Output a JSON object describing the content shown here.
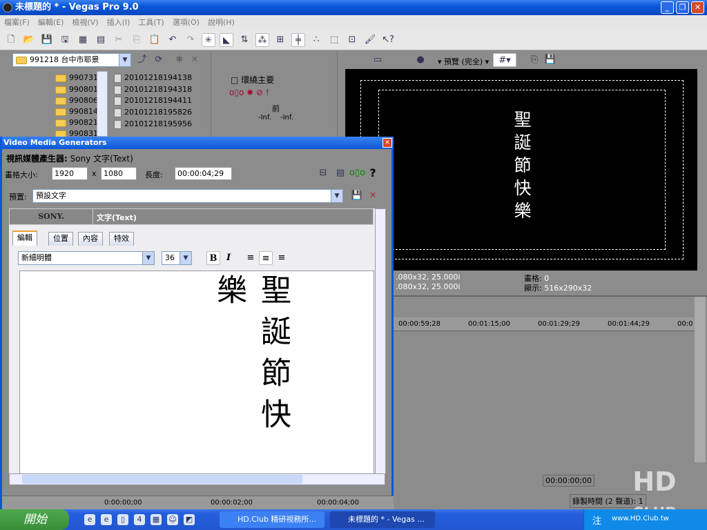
{
  "window": {
    "title": "未標題的 * - Vegas Pro 9.0",
    "min": "_",
    "max": "❐",
    "close": "✕"
  },
  "menu": [
    "檔案(F)",
    "編輯(E)",
    "檢視(V)",
    "插入(I)",
    "工具(T)",
    "選項(O)",
    "說明(H)"
  ],
  "toolbar": {
    "icons": [
      "new-icon",
      "open-icon",
      "save-icon",
      "save-as-icon",
      "render-icon",
      "properties-icon",
      "cut-icon",
      "copy-icon",
      "paste-icon",
      "undo-icon",
      "redo-icon",
      "snap-icon",
      "auto-ripple-icon",
      "lock-envelope-icon",
      "ignore-grouping-icon",
      "normal-edit-tool-icon",
      "envelope-tool-icon",
      "selection-tool-icon",
      "zoom-tool-icon",
      "paint-icon",
      "help-icon"
    ]
  },
  "explorer": {
    "path": "991218 台中市耶景",
    "folders": [
      "990731",
      "990801",
      "990806",
      "990814",
      "990821",
      "990831"
    ],
    "files": [
      "20101218194138",
      "20101218194318",
      "20101218194411",
      "20101218195826",
      "20101218195956"
    ]
  },
  "mixer": {
    "bus": "環繞主要",
    "label": "前",
    "left": "-Inf.",
    "right": "-Inf."
  },
  "preview": {
    "mode": "預覽 (完全)",
    "text": "聖誕節快樂",
    "project_line1": ".080x32, 25.000i",
    "project_line2": ".080x32, 25.000i",
    "frame_label": "畫格:",
    "frame": "0",
    "display_label": "顯示:",
    "display": "516x290x32"
  },
  "timeline": {
    "ticks": [
      "00:00:59;28",
      "00:01:15;00",
      "00:01:29;29",
      "00:01:44;29",
      "00:0"
    ],
    "time": "00:00:00;00",
    "record": "錄製時間 (2 聲道): 1"
  },
  "dialog": {
    "title": "Video Media Generators",
    "gen_label": "視訊媒體產生器:",
    "gen_name": "Sony 文字(Text)",
    "frame_size_label": "畫格大小:",
    "width": "1920",
    "x": "x",
    "height": "1080",
    "length_label": "長度:",
    "length": "00:00:04;29",
    "preset_label": "預置:",
    "preset": "預設文字",
    "brand": "SONY.",
    "plugin": "文字(Text)",
    "tabs": [
      "編輯",
      "位置",
      "內容",
      "特效"
    ],
    "font": "新細明體",
    "size": "36",
    "bold": "B",
    "italic": "I",
    "text": "聖誕節快樂",
    "ruler": [
      "0:00:00;00",
      "00:00:02;00",
      "00:00:04;00"
    ]
  },
  "taskbar": {
    "start": "開始",
    "tasks": [
      "HD.Club 精研視務所...",
      "未標題的 * - Vegas ..."
    ],
    "tray": "www.HD.Club.tw",
    "ime": "注"
  },
  "watermark": "HD CLUB"
}
